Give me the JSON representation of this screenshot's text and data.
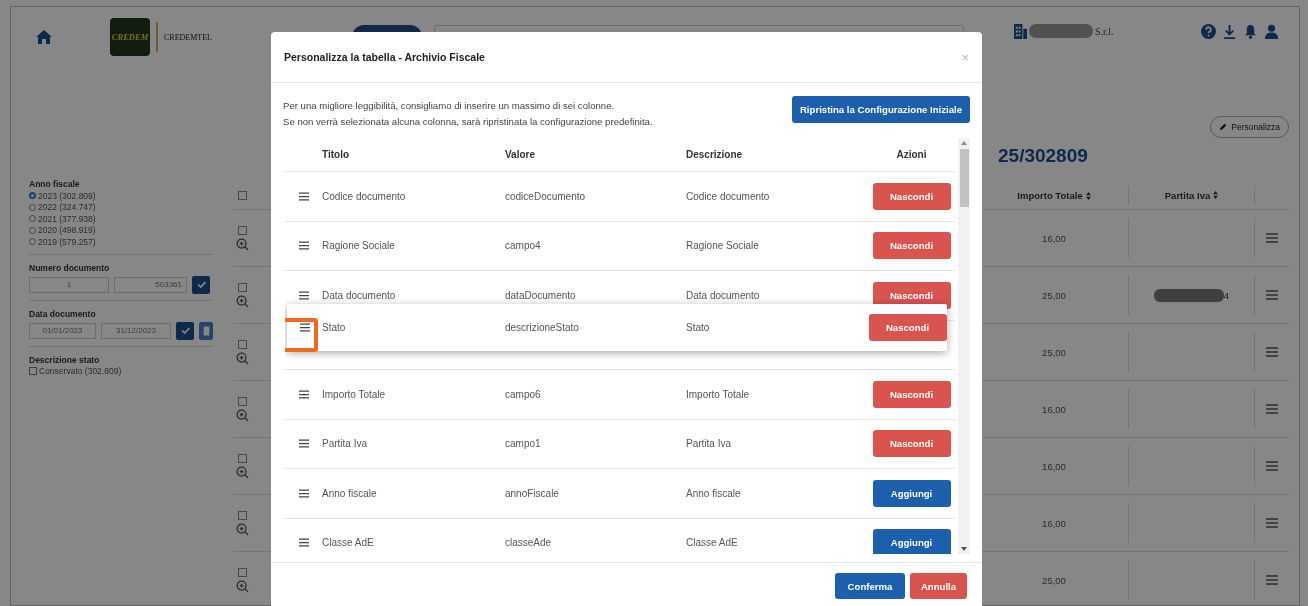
{
  "app": {
    "logo_text": "CREDEM",
    "brand": "CREDEMTEL",
    "company_suffix": "S.r.l."
  },
  "filters": {
    "fiscal_year": {
      "label": "Anno fiscale",
      "options": [
        {
          "label": "2023 (302.809)",
          "selected": true
        },
        {
          "label": "2022 (324.747)",
          "selected": false
        },
        {
          "label": "2021 (377.938)",
          "selected": false
        },
        {
          "label": "2020 (498.919)",
          "selected": false
        },
        {
          "label": "2019 (579.257)",
          "selected": false
        }
      ]
    },
    "document_number": {
      "label": "Numero documento",
      "from": "1",
      "to": "503361"
    },
    "document_date": {
      "label": "Data documento",
      "from": "01/01/2023",
      "to": "31/12/2023"
    },
    "status": {
      "label": "Descrizione stato",
      "options": [
        {
          "label": "Conservato (302.809)",
          "checked": false
        }
      ]
    }
  },
  "page": {
    "customize_button": "Personalizza",
    "count": "25/302809"
  },
  "table": {
    "select_all_checked": false,
    "columns": [
      "Importo Totale",
      "Partita Iva"
    ],
    "rows": [
      {
        "importo": "16,00",
        "checked": false
      },
      {
        "importo": "25,00",
        "partita_iva": "4",
        "redacted": true,
        "checked": false
      },
      {
        "importo": "25,00",
        "checked": false
      },
      {
        "importo": "16,00",
        "checked": false
      },
      {
        "importo": "16,00",
        "checked": false
      },
      {
        "importo": "16,00",
        "checked": false
      },
      {
        "importo": "25,00",
        "checked": false
      }
    ]
  },
  "dialog": {
    "title": "Personalizza la tabella - Archivio Fiscale",
    "close": "×",
    "intro": [
      "Per una migliore leggibilità, consigliamo di inserire un massimo di sei colonne.",
      "Se non verrà selezionata alcuna colonna, sarà ripristinata la configurazione predefinita."
    ],
    "reset_button": "Ripristina la Configurazione Iniziale",
    "columns": [
      "Titolo",
      "Valore",
      "Descrizione",
      "Azioni"
    ],
    "rows": [
      {
        "title": "Codice documento",
        "value": "codiceDocumento",
        "description": "Codice documento",
        "action": {
          "kind": "hide",
          "label": "Nascondi"
        },
        "dragging": false
      },
      {
        "title": "Ragione Sociale",
        "value": "campo4",
        "description": "Ragione Sociale",
        "action": {
          "kind": "hide",
          "label": "Nascondi"
        },
        "dragging": false
      },
      {
        "title": "Data documento",
        "value": "dataDocumento",
        "description": "Data documento",
        "action": {
          "kind": "hide",
          "label": "Nascondi"
        },
        "dragging": false
      },
      {
        "title": "Stato",
        "value": "descrizioneStato",
        "description": "Stato",
        "action": {
          "kind": "hide",
          "label": "Nascondi"
        },
        "dragging": true,
        "highlighted": true
      },
      {
        "title": "Importo Totale",
        "value": "campo6",
        "description": "Importo Totale",
        "action": {
          "kind": "hide",
          "label": "Nascondi"
        },
        "dragging": false
      },
      {
        "title": "Partita Iva",
        "value": "campo1",
        "description": "Partita Iva",
        "action": {
          "kind": "hide",
          "label": "Nascondi"
        },
        "dragging": false
      },
      {
        "title": "Anno fiscale",
        "value": "annoFiscale",
        "description": "Anno fiscale",
        "action": {
          "kind": "add",
          "label": "Aggiungi"
        },
        "dragging": false
      },
      {
        "title": "Classe AdE",
        "value": "classeAde",
        "description": "Classe AdE",
        "action": {
          "kind": "add",
          "label": "Aggiungi"
        },
        "dragging": false
      }
    ],
    "confirm_button": "Conferma",
    "cancel_button": "Annulla"
  }
}
